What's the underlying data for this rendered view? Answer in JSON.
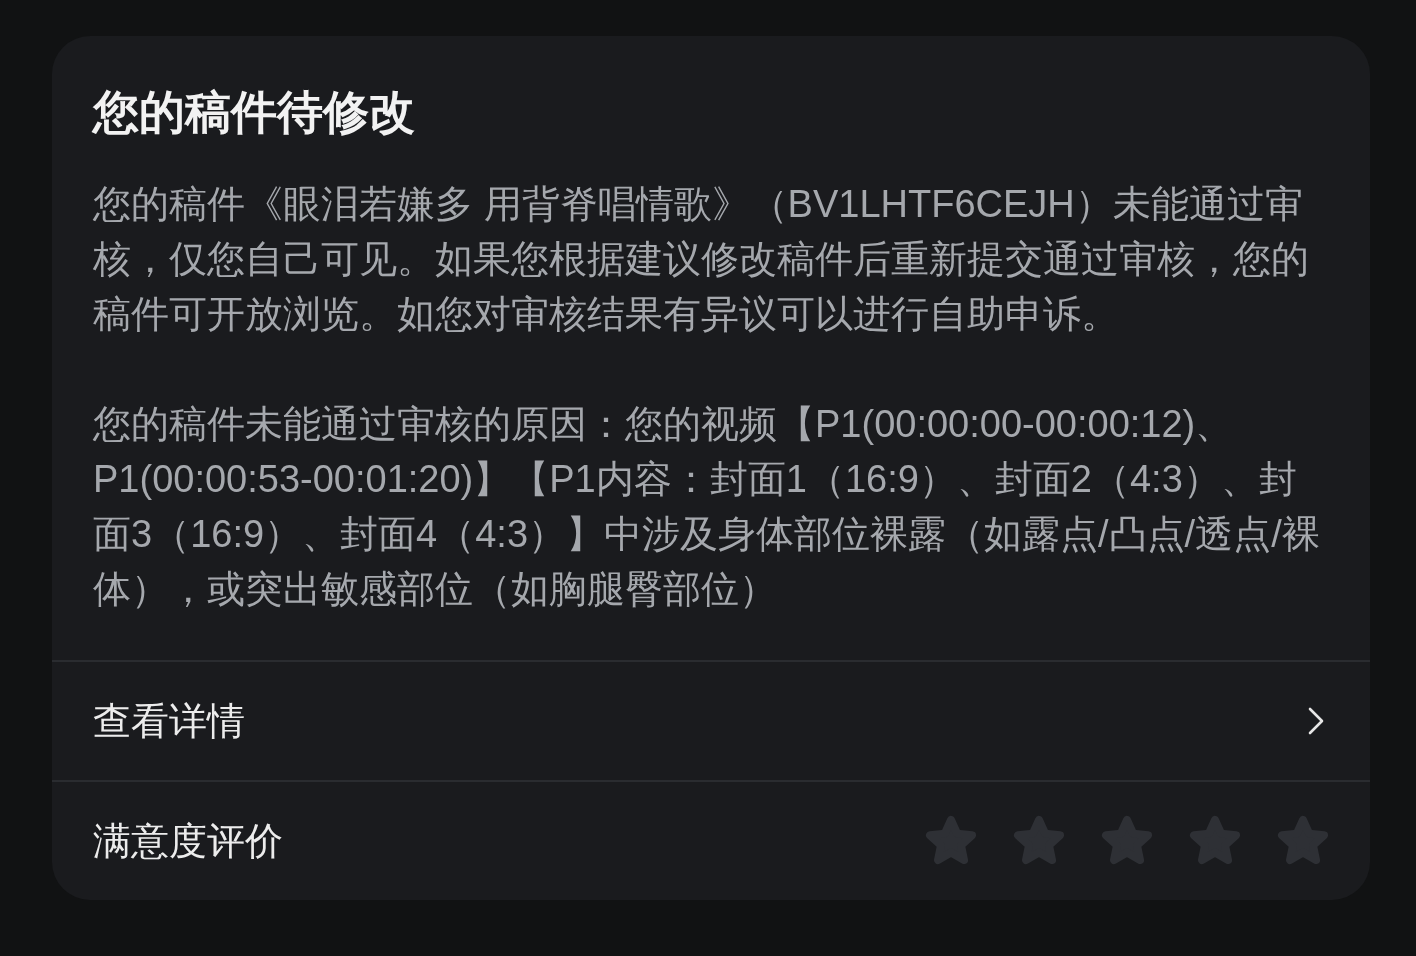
{
  "card": {
    "title": "您的稿件待修改",
    "paragraphs": [
      "您的稿件《眼泪若嫌多 用背脊唱情歌》（BV1LHTF6CEJH）未能通过审核，仅您自己可见。如果您根据建议修改稿件后重新提交通过审核，您的稿件可开放浏览。如您对审核结果有异议可以进行自助申诉。",
      "您的稿件未能通过审核的原因：您的视频【P1(00:00:00-00:00:12)、P1(00:00:53-00:01:20)】【P1内容：封面1（16:9）、封面2（4:3）、封面3（16:9）、封面4（4:3）】中涉及身体部位裸露（如露点/凸点/透点/裸体），或突出敏感部位（如胸腿臀部位）"
    ]
  },
  "rows": [
    {
      "kind": "link",
      "label": "查看详情"
    },
    {
      "kind": "rating",
      "label": "满意度评价",
      "stars": 0
    }
  ]
}
